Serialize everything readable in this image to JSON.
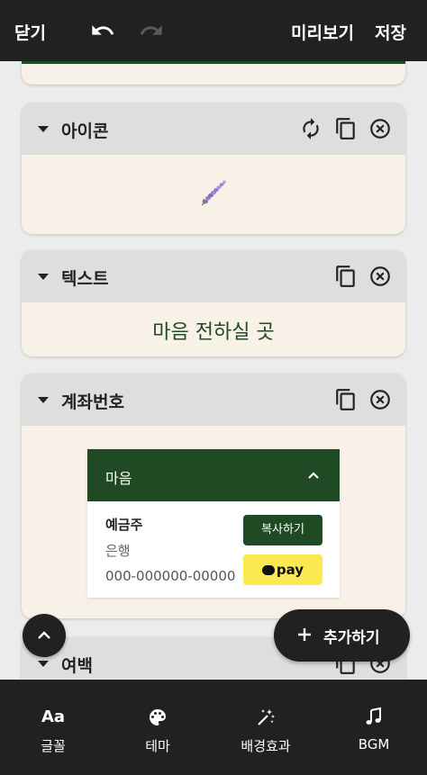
{
  "topbar": {
    "close_label": "닫기",
    "preview_label": "미리보기",
    "save_label": "저장"
  },
  "sections": {
    "icon": {
      "title": "아이콘"
    },
    "text": {
      "title": "텍스트",
      "body": "마음 전하실 곳"
    },
    "account": {
      "title": "계좌번호",
      "box_label": "마음",
      "holder": "예금주",
      "bank": "은행",
      "number": "000-000000-00000",
      "copy_label": "복사하기",
      "pay_label": "pay"
    },
    "spacing": {
      "title": "여백"
    }
  },
  "add_button": {
    "label": "추가하기"
  },
  "bottom_nav": {
    "font": {
      "icon_text": "Aa",
      "label": "글꼴"
    },
    "theme": {
      "label": "테마"
    },
    "effects": {
      "label": "배경효과"
    },
    "bgm": {
      "label": "BGM"
    }
  },
  "colors": {
    "accent": "#1f4a24",
    "dark": "#212121",
    "card_bg": "#f8f1e7",
    "pay_yellow": "#fce94f"
  }
}
